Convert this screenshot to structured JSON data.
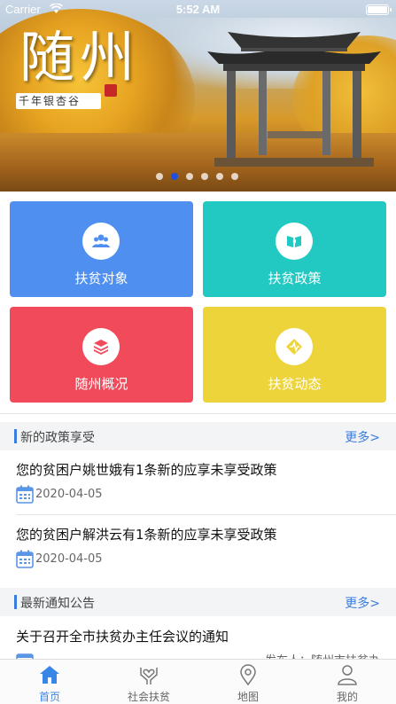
{
  "status_bar": {
    "carrier": "Carrier",
    "time": "5:52 AM"
  },
  "banner": {
    "title": "随州",
    "subtitle": "千年银杏谷",
    "slide_count": 6,
    "active_slide": 2
  },
  "tiles": [
    {
      "label": "扶贫对象",
      "color": "#4f8ff0",
      "icon": "people-icon"
    },
    {
      "label": "扶贫政策",
      "color": "#22c8c2",
      "icon": "book-icon"
    },
    {
      "label": "随州概况",
      "color": "#f14a5b",
      "icon": "layers-icon"
    },
    {
      "label": "扶贫动态",
      "color": "#ecd43a",
      "icon": "activity-icon"
    }
  ],
  "policy_section": {
    "title": "新的政策享受",
    "more": "更多>",
    "items": [
      {
        "title": "您的贫困户姚世娥有1条新的应享未享受政策",
        "date": "2020-04-05"
      },
      {
        "title": "您的贫困户解洪云有1条新的应享未享受政策",
        "date": "2020-04-05"
      }
    ]
  },
  "notice_section": {
    "title": "最新通知公告",
    "more": "更多>",
    "items": [
      {
        "title": "关于召开全市扶贫办主任会议的通知",
        "meta": "发布人：随州市扶贫办"
      }
    ]
  },
  "tabbar": {
    "active_color": "#3a86e6",
    "items": [
      {
        "label": "首页",
        "icon": "home-icon",
        "active": true
      },
      {
        "label": "社会扶贫",
        "icon": "hands-heart-icon",
        "active": false
      },
      {
        "label": "地图",
        "icon": "location-pin-icon",
        "active": false
      },
      {
        "label": "我的",
        "icon": "user-icon",
        "active": false
      }
    ]
  }
}
